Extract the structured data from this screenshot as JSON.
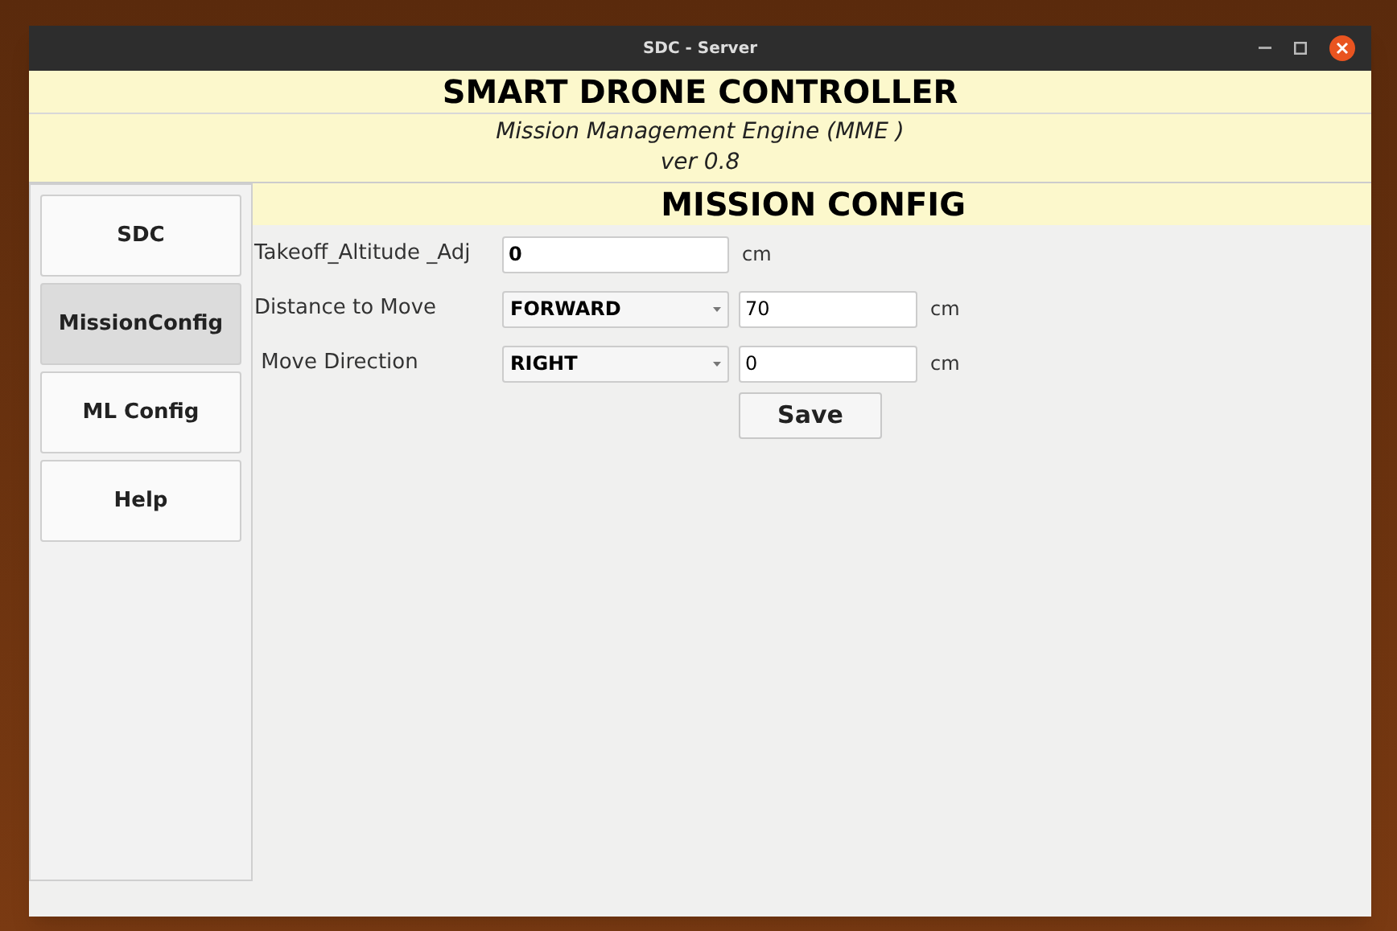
{
  "window": {
    "title": "SDC - Server"
  },
  "header": {
    "title": "SMART DRONE CONTROLLER",
    "subtitle": "Mission Management Engine  (MME )",
    "version": "ver 0.8"
  },
  "sidebar": {
    "items": [
      {
        "label": "SDC",
        "selected": false
      },
      {
        "label": "MissionConfig",
        "selected": true
      },
      {
        "label": "ML Config",
        "selected": false
      },
      {
        "label": "Help",
        "selected": false
      }
    ]
  },
  "panel": {
    "title": "MISSION CONFIG",
    "rows": [
      {
        "kind": "input",
        "label": "Takeoff_Altitude _Adj",
        "value": "0",
        "unit": "cm"
      },
      {
        "kind": "select_input",
        "label": "Distance to Move",
        "select": "FORWARD",
        "value": "70",
        "unit": "cm"
      },
      {
        "kind": "select_input",
        "label": " Move Direction",
        "select": "RIGHT",
        "value": "0",
        "unit": "cm"
      }
    ],
    "save_button": "Save"
  }
}
